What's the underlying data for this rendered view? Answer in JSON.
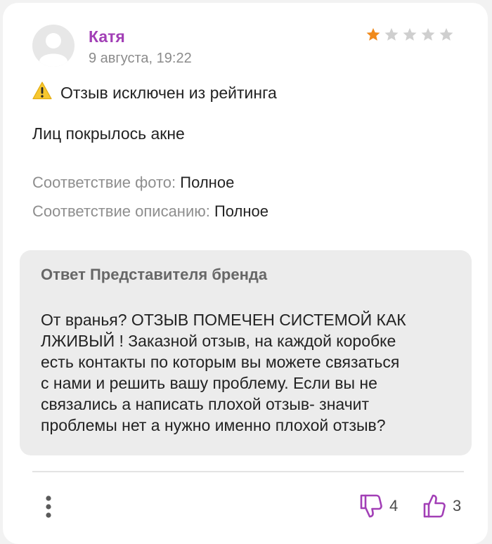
{
  "review": {
    "author": "Катя",
    "date": "9 августа, 19:22",
    "rating": 1,
    "rating_max": 5,
    "excluded_notice": "Отзыв исключен из рейтинга",
    "text": "Лиц покрылось акне",
    "attributes": [
      {
        "label": "Соответствие фото:",
        "value": "Полное"
      },
      {
        "label": "Соответствие описанию:",
        "value": "Полное"
      }
    ]
  },
  "reply": {
    "title": "Ответ Представителя бренда",
    "lines": [
      "От вранья? ОТЗЫВ ПОМЕЧЕН СИСТЕМОЙ КАК",
      "ЛЖИВЫЙ ! Заказной отзыв, на каждой коробке",
      "есть контакты по которым вы можете связаться",
      "с нами и решить вашу проблему. Если вы не",
      "связались а написать плохой отзыв- значит",
      "проблемы нет а нужно именно плохой отзыв?"
    ]
  },
  "actions": {
    "dislike_count": "4",
    "like_count": "3",
    "more_icon": "more-vertical-icon",
    "dislike_icon": "thumbs-down-icon",
    "like_icon": "thumbs-up-icon"
  },
  "colors": {
    "author": "#a23fb6",
    "accent": "#a23fb6",
    "star_filled": "#f08a1c",
    "star_empty": "#cfcfcf",
    "reply_bg": "#ececec"
  }
}
